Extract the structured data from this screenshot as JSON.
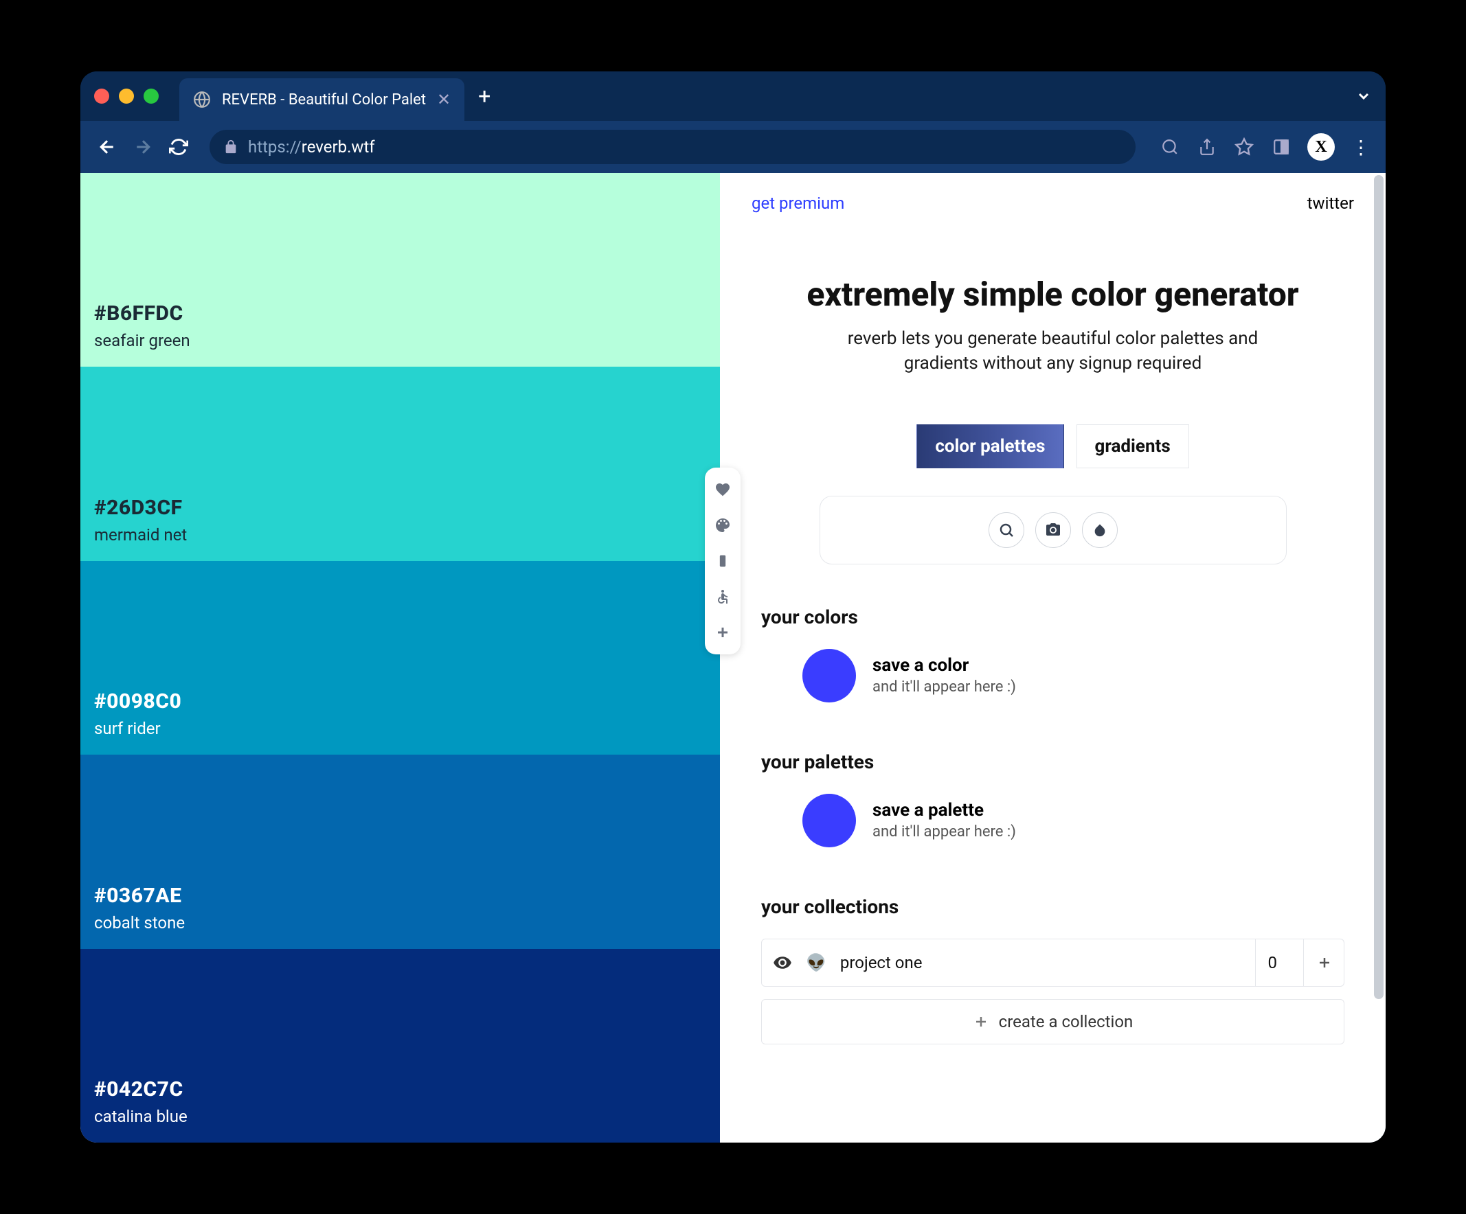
{
  "browser": {
    "tab_title": "REVERB - Beautiful Color Palet",
    "url_prefix": "https://",
    "url_host": "reverb.wtf",
    "avatar_letter": "X"
  },
  "palette": [
    {
      "hex": "#B6FFDC",
      "name": "seafair green",
      "bg": "#b6ffdc",
      "text": "dark"
    },
    {
      "hex": "#26D3CF",
      "name": "mermaid net",
      "bg": "#26d3cf",
      "text": "dark"
    },
    {
      "hex": "#0098C0",
      "name": "surf rider",
      "bg": "#0098c0",
      "text": "light"
    },
    {
      "hex": "#0367AE",
      "name": "cobalt stone",
      "bg": "#0367ae",
      "text": "light"
    },
    {
      "hex": "#042C7C",
      "name": "catalina blue",
      "bg": "#042c7c",
      "text": "light"
    }
  ],
  "links": {
    "premium": "get premium",
    "twitter": "twitter"
  },
  "hero": {
    "title": "extremely simple color generator",
    "subtitle": "reverb lets you generate beautiful color palettes and gradients without any signup required"
  },
  "modes": {
    "palettes": "color palettes",
    "gradients": "gradients"
  },
  "sections": {
    "colors": {
      "title": "your colors",
      "cta_title": "save a color",
      "cta_sub": "and it'll appear here :)"
    },
    "palettes": {
      "title": "your palettes",
      "cta_title": "save a palette",
      "cta_sub": "and it'll appear here :)"
    },
    "collections": {
      "title": "your collections",
      "item": {
        "name": "project one",
        "emoji": "👽",
        "count": "0"
      },
      "create": "create a collection"
    }
  }
}
